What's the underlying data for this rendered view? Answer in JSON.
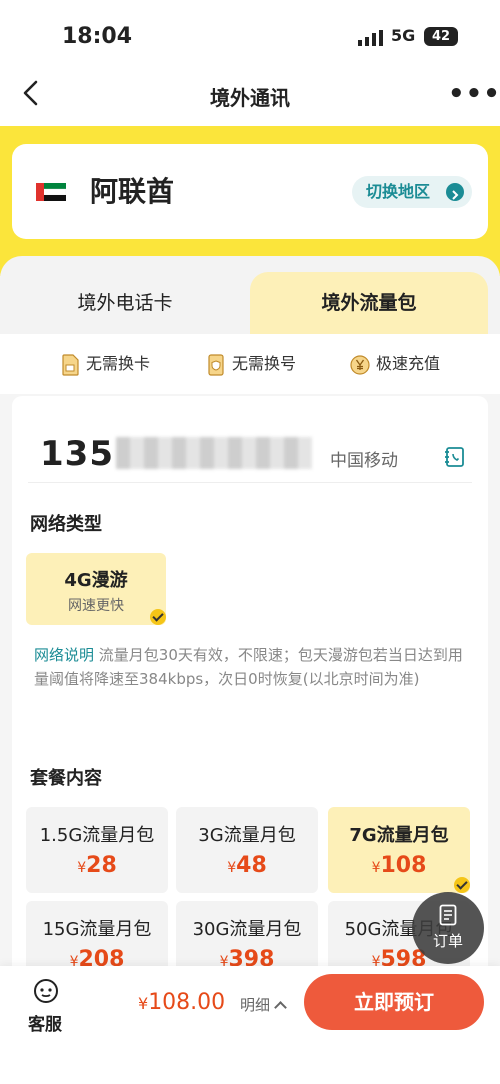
{
  "status": {
    "time": "18:04",
    "network": "5G",
    "battery": "42"
  },
  "nav": {
    "title": "境外通讯",
    "more": "•••"
  },
  "region": {
    "country": "阿联酋",
    "switch_label": "切换地区"
  },
  "tabs": [
    {
      "label": "境外电话卡",
      "active": false
    },
    {
      "label": "境外流量包",
      "active": true
    }
  ],
  "features": [
    "无需换卡",
    "无需换号",
    "极速充值"
  ],
  "phone": {
    "prefix": "135",
    "carrier": "中国移动"
  },
  "network": {
    "title": "网络类型",
    "option": {
      "name": "4G漫游",
      "desc": "网速更快"
    },
    "note_label": "网络说明",
    "note": "流量月包30天有效，不限速；包天漫游包若当日达到用量阈值将降速至384kbps，次日0时恢复(以北京时间为准)"
  },
  "packages": {
    "title": "套餐内容",
    "currency": "¥",
    "items": [
      {
        "name": "1.5G流量月包",
        "price": "28"
      },
      {
        "name": "3G流量月包",
        "price": "48"
      },
      {
        "name": "7G流量月包",
        "price": "108",
        "selected": true
      },
      {
        "name": "15G流量月包",
        "price": "208"
      },
      {
        "name": "30G流量月包",
        "price": "398"
      },
      {
        "name": "50G流量月包",
        "price": "598"
      }
    ]
  },
  "bottom": {
    "service_label": "客服",
    "currency": "¥",
    "total": "108.00",
    "detail_label": "明细",
    "order_button": "立即预订"
  },
  "float": {
    "label": "订单"
  },
  "colors": {
    "yellow": "#fbe53b",
    "accent": "#ee5a3c",
    "teal": "#1b8c95",
    "price": "#e64a19"
  }
}
